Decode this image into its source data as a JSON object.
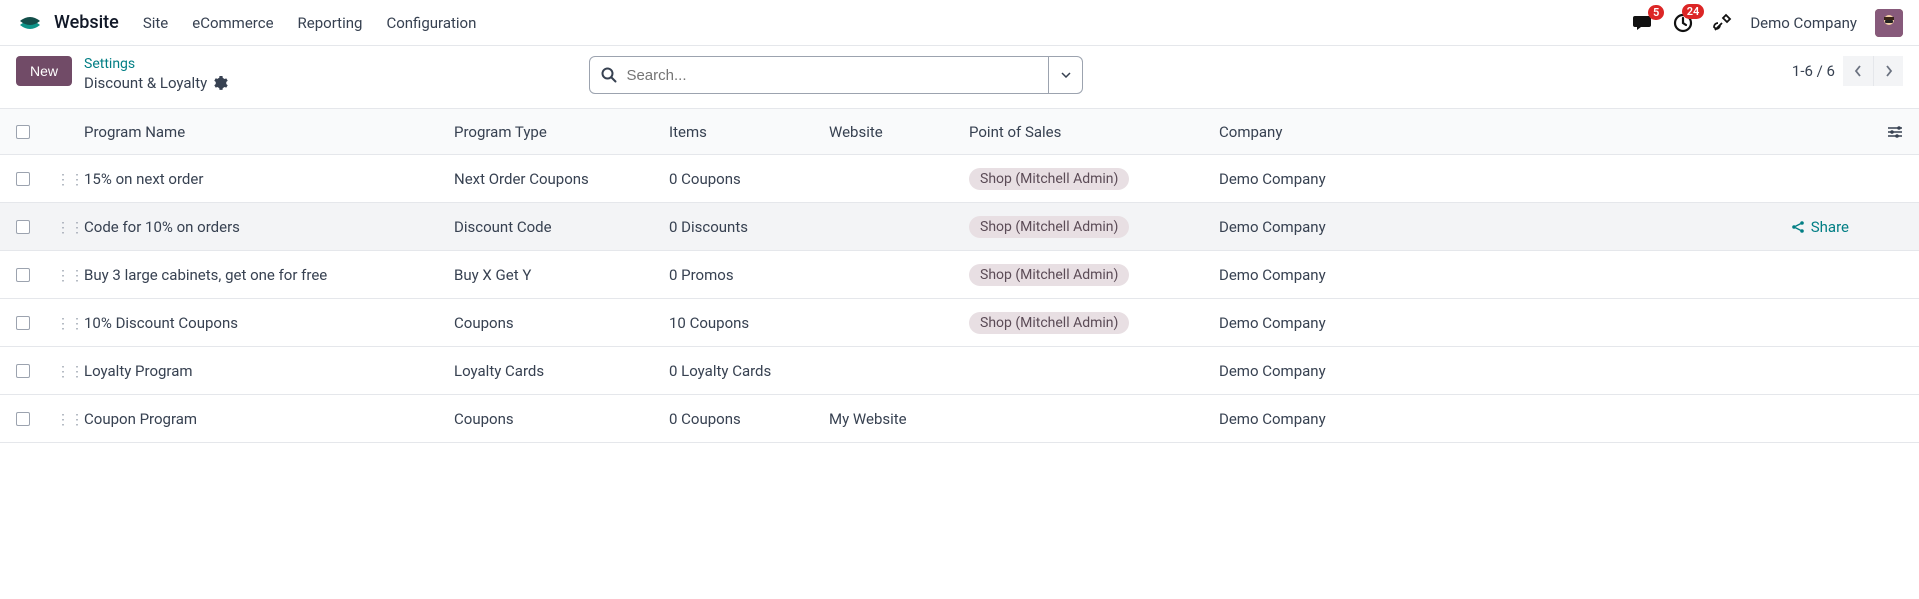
{
  "app_title": "Website",
  "nav_items": [
    "Site",
    "eCommerce",
    "Reporting",
    "Configuration"
  ],
  "badges": {
    "messages": "5",
    "activities": "24"
  },
  "company_name": "Demo Company",
  "btn_new": "New",
  "breadcrumb": {
    "parent": "Settings",
    "current": "Discount & Loyalty"
  },
  "search": {
    "placeholder": "Search..."
  },
  "pager": "1-6 / 6",
  "share_label": "Share",
  "columns": {
    "name": "Program Name",
    "type": "Program Type",
    "items": "Items",
    "website": "Website",
    "pos": "Point of Sales",
    "company": "Company"
  },
  "rows": [
    {
      "name": "15% on next order",
      "type": "Next Order Coupons",
      "items": "0 Coupons",
      "website": "",
      "pos": "Shop (Mitchell Admin)",
      "company": "Demo Company",
      "hovered": false
    },
    {
      "name": "Code for 10% on orders",
      "type": "Discount Code",
      "items": "0 Discounts",
      "website": "",
      "pos": "Shop (Mitchell Admin)",
      "company": "Demo Company",
      "hovered": true
    },
    {
      "name": "Buy 3 large cabinets, get one for free",
      "type": "Buy X Get Y",
      "items": "0 Promos",
      "website": "",
      "pos": "Shop (Mitchell Admin)",
      "company": "Demo Company",
      "hovered": false
    },
    {
      "name": "10% Discount Coupons",
      "type": "Coupons",
      "items": "10 Coupons",
      "website": "",
      "pos": "Shop (Mitchell Admin)",
      "company": "Demo Company",
      "hovered": false
    },
    {
      "name": "Loyalty Program",
      "type": "Loyalty Cards",
      "items": "0 Loyalty Cards",
      "website": "",
      "pos": "",
      "company": "Demo Company",
      "hovered": false
    },
    {
      "name": "Coupon Program",
      "type": "Coupons",
      "items": "0 Coupons",
      "website": "My Website",
      "pos": "",
      "company": "Demo Company",
      "hovered": false
    }
  ]
}
